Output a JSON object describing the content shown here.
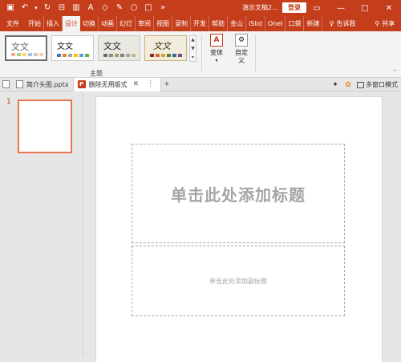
{
  "window": {
    "title": "演示文稿2...",
    "login_label": "登录",
    "controls": {
      "restore": "▭",
      "minimize": "—",
      "maximize": "□",
      "close": "✕"
    }
  },
  "quick_access": [
    "save-icon",
    "undo-icon",
    "redo-icon",
    "format-painter-icon",
    "new-slide-icon",
    "text-icon",
    "shape-icon",
    "pen-icon",
    "circle-icon",
    "rectangle-icon",
    "more-icon"
  ],
  "tabs": [
    {
      "label": "文件"
    },
    {
      "label": "开始"
    },
    {
      "label": "插入"
    },
    {
      "label": "设计",
      "active": true
    },
    {
      "label": "切换"
    },
    {
      "label": "动画"
    },
    {
      "label": "幻灯"
    },
    {
      "label": "审阅"
    },
    {
      "label": "视图"
    },
    {
      "label": "录制"
    },
    {
      "label": "开发"
    },
    {
      "label": "帮助"
    },
    {
      "label": "金山"
    },
    {
      "label": "iSlid"
    },
    {
      "label": "OneI"
    },
    {
      "label": "口袋"
    },
    {
      "label": "新建"
    }
  ],
  "tell_me": "告诉我",
  "share": "共享",
  "ribbon": {
    "themes": [
      {
        "text": "文文",
        "colors": [
          "#f4b183",
          "#a9d18e",
          "#ffd966",
          "#9dc3e6",
          "#c9c9c9",
          "#f8cbad"
        ]
      },
      {
        "text": "文文",
        "colors": [
          "#4472c4",
          "#ed7d31",
          "#a5a5a5",
          "#ffc000",
          "#5b9bd5",
          "#70ad47"
        ]
      },
      {
        "text": "文文",
        "colors": [
          "#6b6b6b",
          "#8a8a8a",
          "#b59b6b",
          "#7f7f7f",
          "#a5a5a5",
          "#c9b28b"
        ]
      },
      {
        "text": "文文",
        "colors": [
          "#8c2b2b",
          "#c86f2b",
          "#d8a338",
          "#5d7a3a",
          "#3a6b8c",
          "#7a4b8c"
        ]
      }
    ],
    "group_label": "主题",
    "variant_label": "变体",
    "customize_label_1": "自定",
    "customize_label_2": "义"
  },
  "doc_tabs": [
    {
      "label": "简介头图.pptx",
      "active": false
    },
    {
      "label": "删除无用版式",
      "active": true
    }
  ],
  "doc_right": {
    "multi_window": "多窗口模式"
  },
  "slides": [
    {
      "number": "1"
    }
  ],
  "slide": {
    "title_placeholder": "单击此处添加标题",
    "subtitle_placeholder": "单击此处添加副标题"
  },
  "colors": {
    "accent": "#c43e1c",
    "selection": "#e9764b"
  }
}
